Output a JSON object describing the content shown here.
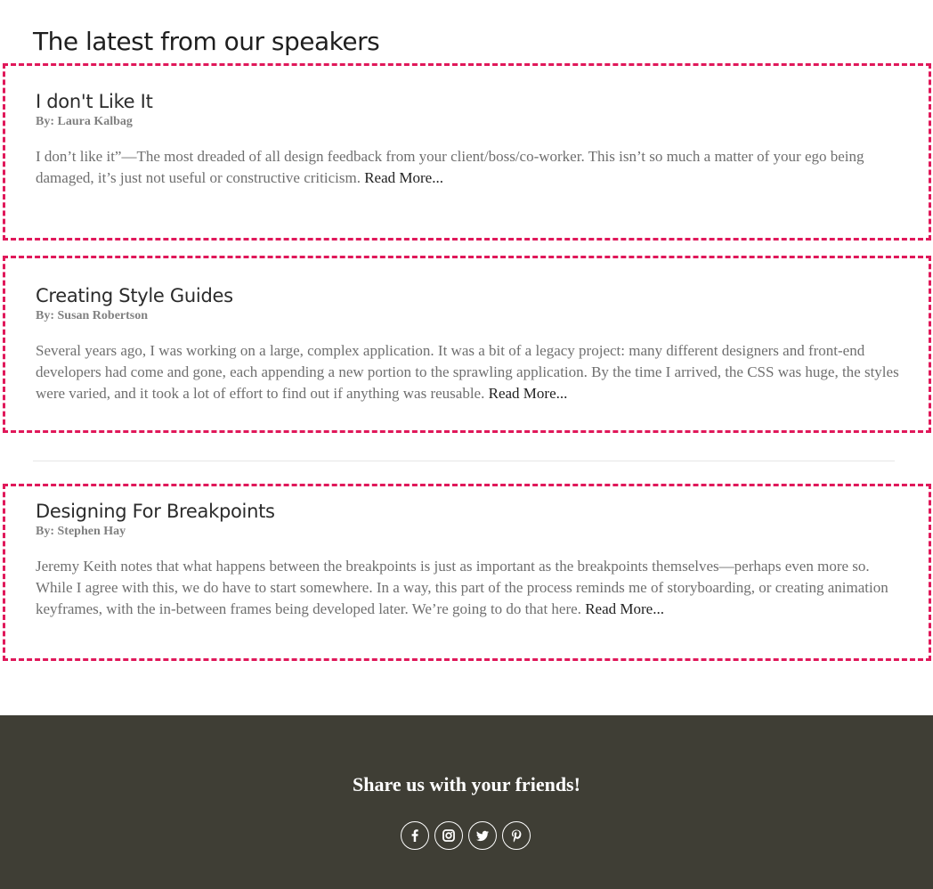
{
  "section": {
    "title": "The latest from our speakers"
  },
  "posts": [
    {
      "title": "I don't Like It",
      "author": "By: Laura Kalbag",
      "excerpt": "I don’t like it”—The most dreaded of all design feedback from your client/boss/co-worker. This isn’t so much a matter of your ego being damaged, it’s just not useful or constructive criticism.",
      "read_more": "Read More..."
    },
    {
      "title": "Creating Style Guides",
      "author": "By: Susan Robertson",
      "excerpt": "Several years ago, I was working on a large, complex application. It was a bit of a legacy project: many different designers and front-end developers had come and gone, each appending a new portion to the sprawling application. By the time I arrived, the CSS was huge, the styles were varied, and it took a lot of effort to find out if anything was reusable.",
      "read_more": "Read More..."
    },
    {
      "title": "Designing For Breakpoints",
      "author": "By: Stephen Hay",
      "excerpt": "Jeremy Keith notes that what happens between the breakpoints is just as important as the breakpoints themselves—perhaps even more so. While I agree with this, we do have to start somewhere. In a way, this part of the process reminds me of storyboarding, or creating animation keyframes, with the in-between frames being developed later. We’re going to do that here.",
      "read_more": "Read More..."
    }
  ],
  "footer": {
    "heading": "Share us with your friends!",
    "social_icons": [
      "facebook-icon",
      "instagram-icon",
      "twitter-icon",
      "pinterest-icon"
    ]
  },
  "colors": {
    "accent": "#e0185a",
    "footer_bg": "#3f3e35"
  }
}
